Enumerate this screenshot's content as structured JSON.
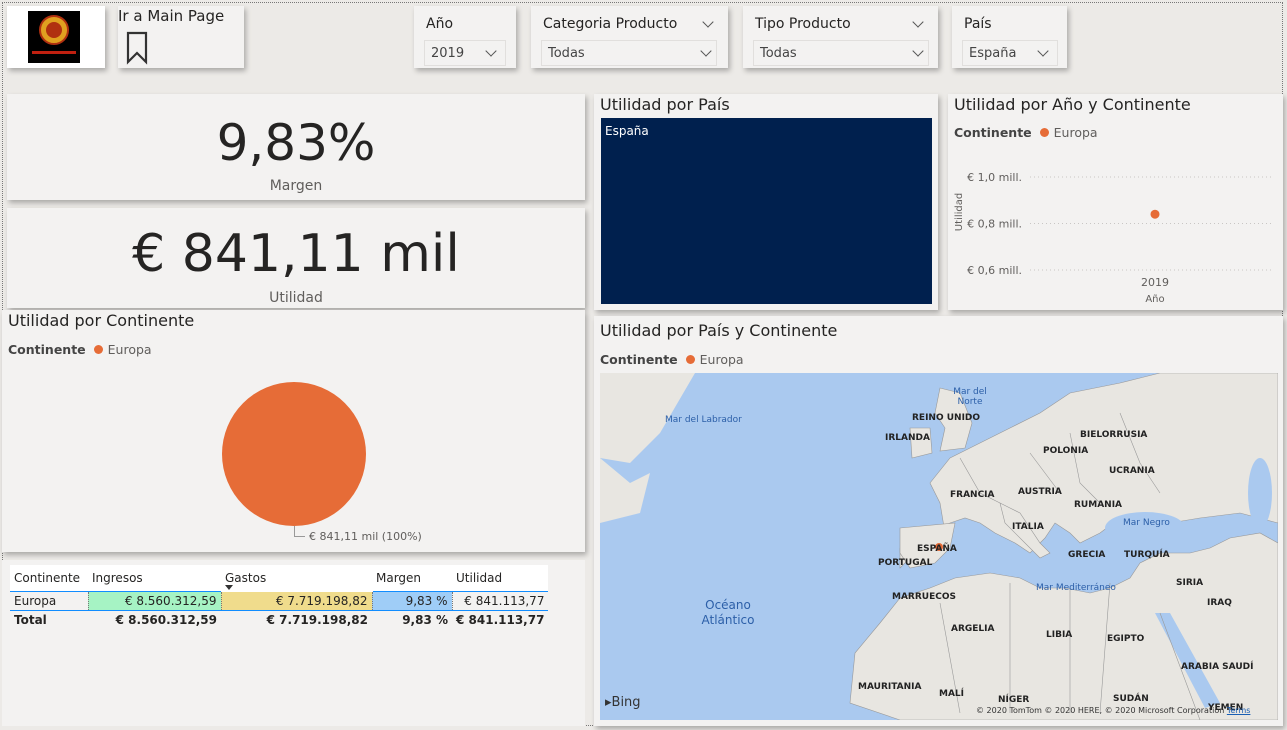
{
  "header": {
    "nav_button_label": "Ir a Main Page"
  },
  "slicers": [
    {
      "title": "Año",
      "value": "2019"
    },
    {
      "title": "Categoria Producto",
      "value": "Todas"
    },
    {
      "title": "Tipo Producto",
      "value": "Todas"
    },
    {
      "title": "País",
      "value": "España"
    }
  ],
  "kpi": {
    "margen_value": "9,83%",
    "margen_label": "Margen",
    "utilidad_value": "€ 841,11 mil",
    "utilidad_label": "Utilidad"
  },
  "treemap": {
    "title": "Utilidad por País",
    "tile_label": "España",
    "tile_color": "#00204e"
  },
  "pie": {
    "title": "Utilidad por Continente",
    "legend_title": "Continente",
    "legend_item": "Europa",
    "slice_label": "€ 841,11 mil (100%)",
    "color": "#e66c37"
  },
  "chart_data": {
    "type": "scatter",
    "title": "Utilidad por Año y Continente",
    "legend_title": "Continente",
    "series": [
      {
        "name": "Europa",
        "x": [
          "2019"
        ],
        "values": [
          0.84
        ]
      }
    ],
    "ylabel": "Utilidad",
    "xlabel": "Año",
    "yticks": [
      "€ 1,0 mill.",
      "€ 0,8 mill.",
      "€ 0,6 mill."
    ],
    "ytick_values": [
      1.0,
      0.8,
      0.6
    ],
    "xticks": [
      "2019"
    ],
    "ylim": [
      0.6,
      1.0
    ]
  },
  "map": {
    "title": "Utilidad por País y Continente",
    "legend_title": "Continente",
    "legend_item": "Europa",
    "attribution": "© 2020 TomTom © 2020 HERE, © 2020 Microsoft Corporation",
    "terms": "Terms",
    "bing": "Bing",
    "sea_labels": [
      "Mar del Norte",
      "Mar del Labrador",
      "Mar Negro",
      "Mar Mediterráneo",
      "Océano Atlántico"
    ],
    "countries": [
      "REINO UNIDO",
      "IRLANDA",
      "BIELORRUSIA",
      "POLONIA",
      "UCRANIA",
      "FRANCIA",
      "AUSTRIA",
      "RUMANIA",
      "ITALIA",
      "ESPAÑA",
      "PORTUGAL",
      "GRECIA",
      "TURQUÍA",
      "SIRIA",
      "IRAQ",
      "MARRUECOS",
      "ARGELIA",
      "LIBIA",
      "EGIPTO",
      "ARABIA SAUDÍ",
      "MAURITANIA",
      "MALÍ",
      "NÍGER",
      "SUDÁN",
      "YEMEN"
    ]
  },
  "matrix": {
    "headers": [
      "Continente",
      "Ingresos",
      "Gastos",
      "Margen",
      "Utilidad"
    ],
    "row": [
      "Europa",
      "€ 8.560.312,59",
      "€ 7.719.198,82",
      "9,83 %",
      "€ 841.113,77"
    ],
    "total": [
      "Total",
      "€ 8.560.312,59",
      "€ 7.719.198,82",
      "9,83 %",
      "€ 841.113,77"
    ],
    "colors": {
      "ingresos": "#a6f3c4",
      "gastos": "#f0dc8c",
      "margen": "#9fcdf7"
    }
  }
}
